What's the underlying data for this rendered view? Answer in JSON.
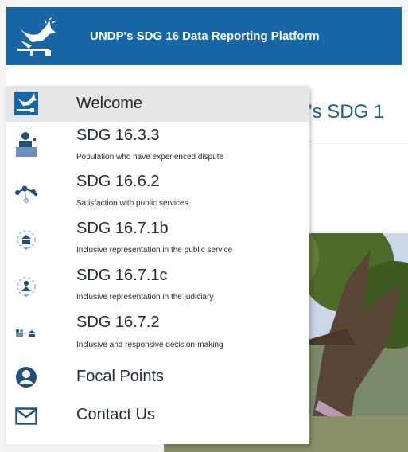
{
  "header": {
    "title": "UNDP's SDG 16 Data Reporting Platform",
    "brand_color": "#1866a6",
    "logo_icon": "dove-logo-icon"
  },
  "page": {
    "heading_fragment": "'s SDG 1"
  },
  "menu": {
    "items": [
      {
        "label": "Welcome",
        "icon": "dove-icon",
        "selected": true
      },
      {
        "label": "SDG 16.3.3",
        "sub": "Population who have experienced dispute",
        "icon": "dispute-person-icon"
      },
      {
        "label": "SDG 16.6.2",
        "sub": "Satisfaction with public services",
        "icon": "network-nodes-icon"
      },
      {
        "label": "SDG 16.7.1b",
        "sub": "Inclusive representation in the public service",
        "icon": "public-service-icon"
      },
      {
        "label": "SDG 16.7.1c",
        "sub": "Inclusive representation in the judiciary",
        "icon": "judiciary-icon"
      },
      {
        "label": "SDG 16.7.2",
        "sub": "Inclusive and responsive decision-making",
        "icon": "decision-making-icon"
      },
      {
        "label": "Focal Points",
        "icon": "user-circle-icon"
      },
      {
        "label": "Contact Us",
        "icon": "envelope-icon"
      }
    ]
  }
}
